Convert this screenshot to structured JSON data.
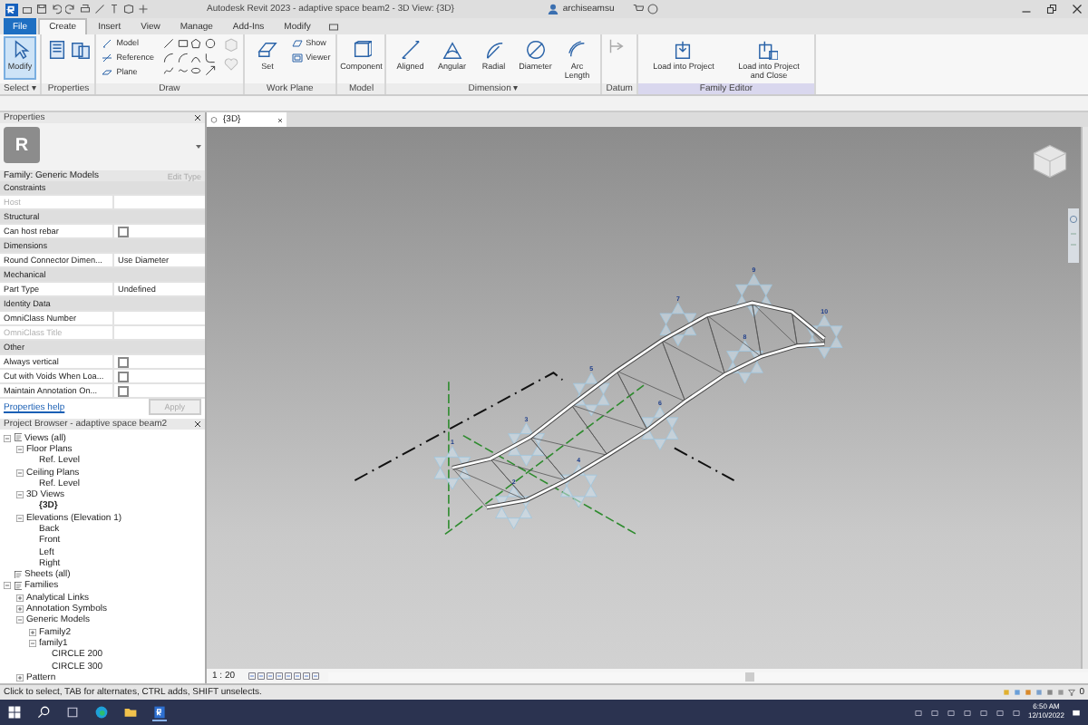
{
  "title_bar": {
    "title": "Autodesk Revit 2023 - adaptive space beam2 - 3D View: {3D}",
    "user": "archiseamsu"
  },
  "ribbon_tabs": [
    {
      "label": "File",
      "selected": false
    },
    {
      "label": "Create",
      "selected": true
    },
    {
      "label": "Insert",
      "selected": false
    },
    {
      "label": "View",
      "selected": false
    },
    {
      "label": "Manage",
      "selected": false
    },
    {
      "label": "Add-Ins",
      "selected": false
    },
    {
      "label": "Modify",
      "selected": false
    }
  ],
  "ribbon_panels": [
    {
      "kind": "select",
      "title": "Select ▾",
      "buttons": [
        {
          "label": "Modify",
          "selected": true
        }
      ]
    },
    {
      "kind": "properties",
      "title": "Properties"
    },
    {
      "kind": "draw",
      "title": "Draw",
      "buttons": [
        {
          "label": "Model"
        },
        {
          "label": "Reference"
        },
        {
          "label": "Plane"
        }
      ]
    },
    {
      "kind": "workplane",
      "title": "Work Plane",
      "buttons": [
        {
          "label": "Set"
        },
        {
          "label": "Show"
        },
        {
          "label": "Viewer"
        }
      ]
    },
    {
      "kind": "model",
      "title": "Model",
      "buttons": [
        {
          "label": "Component"
        }
      ]
    },
    {
      "kind": "dimension",
      "title": "Dimension ▾",
      "buttons": [
        {
          "label": "Aligned"
        },
        {
          "label": "Angular"
        },
        {
          "label": "Radial"
        },
        {
          "label": "Diameter"
        },
        {
          "label": "Arc Length"
        }
      ]
    },
    {
      "kind": "datum",
      "title": "Datum"
    },
    {
      "kind": "family",
      "title": "Family Editor",
      "buttons": [
        {
          "label": "Load into Project"
        },
        {
          "label": "Load into Project and Close"
        }
      ]
    }
  ],
  "properties": {
    "title": "Properties",
    "type_icon_text": "R",
    "type_selector": "Family: Generic Models",
    "edit_type": {
      "label": "Edit Type",
      "disabled": true
    },
    "rows": [
      {
        "kind": "header",
        "label": "Constraints"
      },
      {
        "kind": "text",
        "label": "Host",
        "disabled": true
      },
      {
        "kind": "header",
        "label": "Structural"
      },
      {
        "kind": "check",
        "label": "Can host rebar",
        "checked": false,
        "disabled": false
      },
      {
        "kind": "header",
        "label": "Dimensions"
      },
      {
        "kind": "text",
        "label": "Round Connector Dimen...",
        "value": "Use Diameter",
        "disabled": false
      },
      {
        "kind": "header",
        "label": "Mechanical"
      },
      {
        "kind": "text",
        "label": "Part Type",
        "value": "Undefined",
        "disabled": false
      },
      {
        "kind": "header",
        "label": "Identity Data"
      },
      {
        "kind": "text",
        "label": "OmniClass Number",
        "disabled": false
      },
      {
        "kind": "text",
        "label": "OmniClass Title",
        "disabled": true
      },
      {
        "kind": "header",
        "label": "Other"
      },
      {
        "kind": "check",
        "label": "Always vertical",
        "checked": false,
        "disabled": false
      },
      {
        "kind": "check",
        "label": "Cut with Voids When Loa...",
        "checked": false,
        "disabled": false
      },
      {
        "kind": "check",
        "label": "Maintain Annotation On...",
        "checked": false,
        "disabled": false
      }
    ],
    "help_link": "Properties help",
    "apply": {
      "label": "Apply",
      "disabled": true
    }
  },
  "project_browser": {
    "title": "Project Browser - adaptive space beam2",
    "tree": [
      {
        "label": "Views (all)",
        "expanded": true,
        "children": [
          {
            "label": "Floor Plans",
            "expanded": true,
            "children": [
              {
                "label": "Ref. Level"
              }
            ]
          },
          {
            "label": "Ceiling Plans",
            "expanded": true,
            "children": [
              {
                "label": "Ref. Level"
              }
            ]
          },
          {
            "label": "3D Views",
            "expanded": true,
            "children": [
              {
                "label": "{3D}",
                "active": true
              }
            ]
          },
          {
            "label": "Elevations (Elevation 1)",
            "expanded": true,
            "children": [
              {
                "label": "Back"
              },
              {
                "label": "Front"
              },
              {
                "label": "Left"
              },
              {
                "label": "Right"
              }
            ]
          }
        ]
      },
      {
        "label": "Sheets (all)"
      },
      {
        "label": "Families",
        "expanded": true,
        "children": [
          {
            "label": "Analytical Links",
            "expanded": false
          },
          {
            "label": "Annotation Symbols",
            "expanded": false
          },
          {
            "label": "Generic Models",
            "expanded": true,
            "children": [
              {
                "label": "Family2",
                "expanded": false
              },
              {
                "label": "family1",
                "expanded": true,
                "children": [
                  {
                    "label": "CIRCLE 200"
                  },
                  {
                    "label": "CIRCLE 300"
                  }
                ]
              }
            ]
          },
          {
            "label": "Pattern",
            "expanded": false
          }
        ]
      }
    ]
  },
  "viewport": {
    "tab": "{3D}",
    "scale": "1 : 20",
    "point_numbers": [
      "1",
      "2",
      "3",
      "4",
      "5",
      "6",
      "7",
      "8",
      "9",
      "10"
    ]
  },
  "status_bar": {
    "text": "Click to select, TAB for alternates, CTRL adds, SHIFT unselects.",
    "filter_count": "0"
  },
  "taskbar": {
    "time": "6:50 AM",
    "date": "12/10/2022"
  }
}
